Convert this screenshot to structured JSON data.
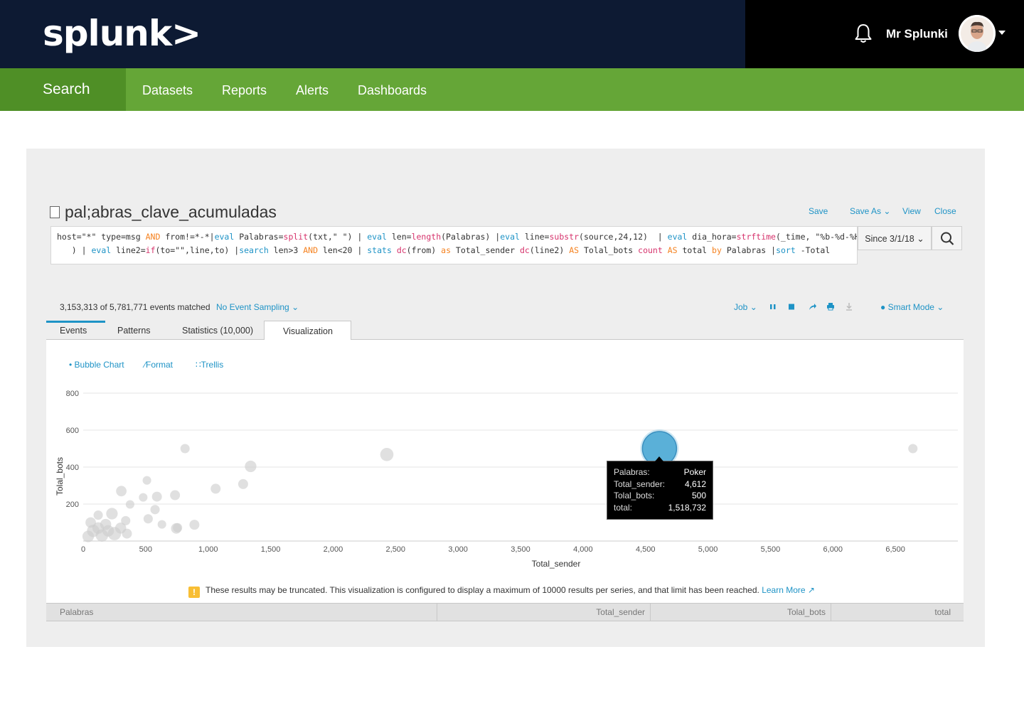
{
  "topbar": {
    "logo": "splunk>",
    "username": "Mr Splunki",
    "icons": [
      "bell-icon",
      "avatar",
      "caret-down-icon"
    ]
  },
  "nav": {
    "items": [
      {
        "label": "Search",
        "active": true
      },
      {
        "label": "Datasets"
      },
      {
        "label": "Reports"
      },
      {
        "label": "Alerts"
      },
      {
        "label": "Dashboards"
      }
    ]
  },
  "report": {
    "title": "pal;abras_clave_acumuladas",
    "actions": [
      "Save",
      "Save As",
      "View",
      "Close"
    ],
    "query_line1": "host=\"*\" type=msg AND from!=*-*|eval Palabras=split(txt,\" \") | eval len=length(Palabras) |eval line=substr(source,24,12)  | eval dia_hora=strftime(_time, \"%b-%d-%H\"",
    "query_line2": "   ) | eval line2=if(to=\"\",line,to) |search len>3 AND len<20 | stats dc(from) as Total_sender dc(line2) AS Tolal_bots count AS total by Palabras |sort -Total",
    "time_range": "Since 3/1/18"
  },
  "status": {
    "events": "3,153,313 of 5,781,771 events matched",
    "sampling": "No Event Sampling",
    "job": "Job",
    "mode": "Smart Mode"
  },
  "tabs": [
    "Events",
    "Patterns",
    "Statistics (10,000)",
    "Visualization"
  ],
  "viz_controls": [
    "Bubble Chart",
    "Format",
    "Trellis"
  ],
  "chart_data": {
    "type": "scatter",
    "subtype": "bubble",
    "xlabel": "Total_sender",
    "ylabel": "Tolal_bots",
    "xlim": [
      0,
      7000
    ],
    "ylim": [
      0,
      800
    ],
    "xticks": [
      0,
      500,
      1000,
      1500,
      2000,
      2500,
      3000,
      3500,
      4000,
      4500,
      5000,
      5500,
      6000,
      6500
    ],
    "xtick_labels": [
      "0",
      "500",
      "1,000",
      "1,500",
      "2,000",
      "2,500",
      "3,000",
      "3,500",
      "4,000",
      "4,500",
      "5,000",
      "5,500",
      "6,000",
      "6,500"
    ],
    "yticks": [
      200,
      400,
      600,
      800
    ],
    "ytick_labels": [
      "200",
      "400",
      "600",
      "800"
    ],
    "grid": true,
    "highlight_color": "#5ab0d8",
    "bubble_color": "#cccccc",
    "points": [
      {
        "x": 4612,
        "y": 500,
        "total": 1518732,
        "highlighted": true
      },
      {
        "x": 6640,
        "y": 500,
        "total": 200000
      },
      {
        "x": 2430,
        "y": 468,
        "total": 600000
      },
      {
        "x": 815,
        "y": 500,
        "total": 200000
      },
      {
        "x": 1340,
        "y": 404,
        "total": 400000
      },
      {
        "x": 1280,
        "y": 308,
        "total": 250000
      },
      {
        "x": 1060,
        "y": 283,
        "total": 250000
      },
      {
        "x": 510,
        "y": 328,
        "total": 150000
      },
      {
        "x": 305,
        "y": 270,
        "total": 300000
      },
      {
        "x": 590,
        "y": 240,
        "total": 250000
      },
      {
        "x": 735,
        "y": 248,
        "total": 250000
      },
      {
        "x": 480,
        "y": 236,
        "total": 150000
      },
      {
        "x": 375,
        "y": 198,
        "total": 150000
      },
      {
        "x": 575,
        "y": 170,
        "total": 200000
      },
      {
        "x": 230,
        "y": 148,
        "total": 400000
      },
      {
        "x": 520,
        "y": 120,
        "total": 200000
      },
      {
        "x": 630,
        "y": 90,
        "total": 150000
      },
      {
        "x": 890,
        "y": 88,
        "total": 250000
      },
      {
        "x": 755,
        "y": 72,
        "total": 200000
      },
      {
        "x": 745,
        "y": 68,
        "total": 300000
      },
      {
        "x": 180,
        "y": 90,
        "total": 350000
      },
      {
        "x": 120,
        "y": 70,
        "total": 400000
      },
      {
        "x": 80,
        "y": 55,
        "total": 500000
      },
      {
        "x": 200,
        "y": 55,
        "total": 400000
      },
      {
        "x": 300,
        "y": 70,
        "total": 350000
      },
      {
        "x": 250,
        "y": 40,
        "total": 600000
      },
      {
        "x": 150,
        "y": 30,
        "total": 500000
      },
      {
        "x": 60,
        "y": 100,
        "total": 300000
      },
      {
        "x": 40,
        "y": 25,
        "total": 400000
      },
      {
        "x": 340,
        "y": 110,
        "total": 200000
      },
      {
        "x": 120,
        "y": 140,
        "total": 200000
      },
      {
        "x": 350,
        "y": 40,
        "total": 250000
      }
    ],
    "tooltip": {
      "rows": [
        {
          "k": "Palabras:",
          "v": "Poker"
        },
        {
          "k": "Total_sender:",
          "v": "4,612"
        },
        {
          "k": "Tolal_bots:",
          "v": "500"
        },
        {
          "k": "total:",
          "v": "1,518,732"
        }
      ]
    }
  },
  "warning": {
    "text": "These results may be truncated. This visualization is configured to display a maximum of 10000 results per series, and that limit has been reached.",
    "link": "Learn More"
  },
  "table": {
    "columns": [
      "Palabras",
      "Total_sender",
      "Tolal_bots",
      "total"
    ]
  }
}
